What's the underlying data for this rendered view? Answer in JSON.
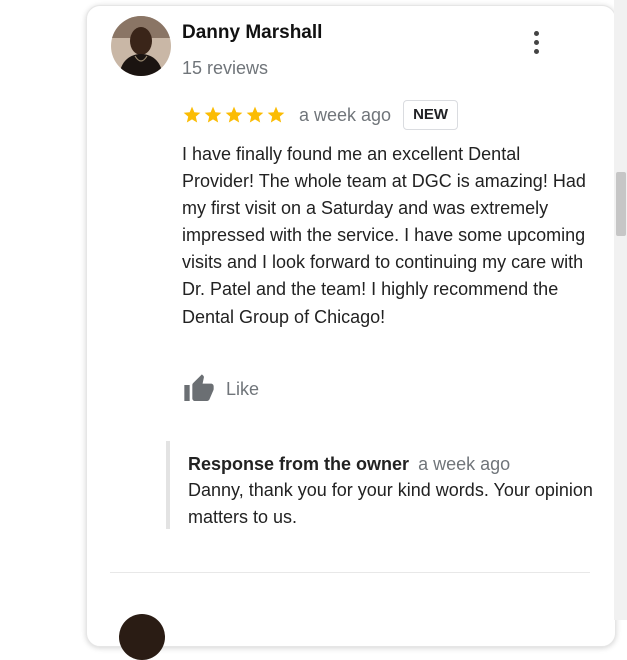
{
  "review": {
    "author": "Danny Marshall",
    "review_count": "15 reviews",
    "rating": 5,
    "time": "a week ago",
    "badge": "NEW",
    "text": "I have finally found me an excellent Dental Provider! The whole team at DGC is amazing! Had my first visit on a Saturday and was extremely impressed with the service. I have some upcoming visits and I look forward to continuing my care with Dr. Patel and the team! I highly recommend the Dental Group of Chicago!",
    "like_label": "Like",
    "owner_response": {
      "title": "Response from the owner",
      "time": "a week ago",
      "text": "Danny, thank you for your kind words. Your opinion matters to us."
    }
  },
  "colors": {
    "star": "#fbbc04",
    "secondary_text": "#70757a",
    "like_icon": "#6b6f73"
  },
  "icons": {
    "menu": "more-vert-icon",
    "like": "thumb-up-icon",
    "star": "star-icon"
  }
}
